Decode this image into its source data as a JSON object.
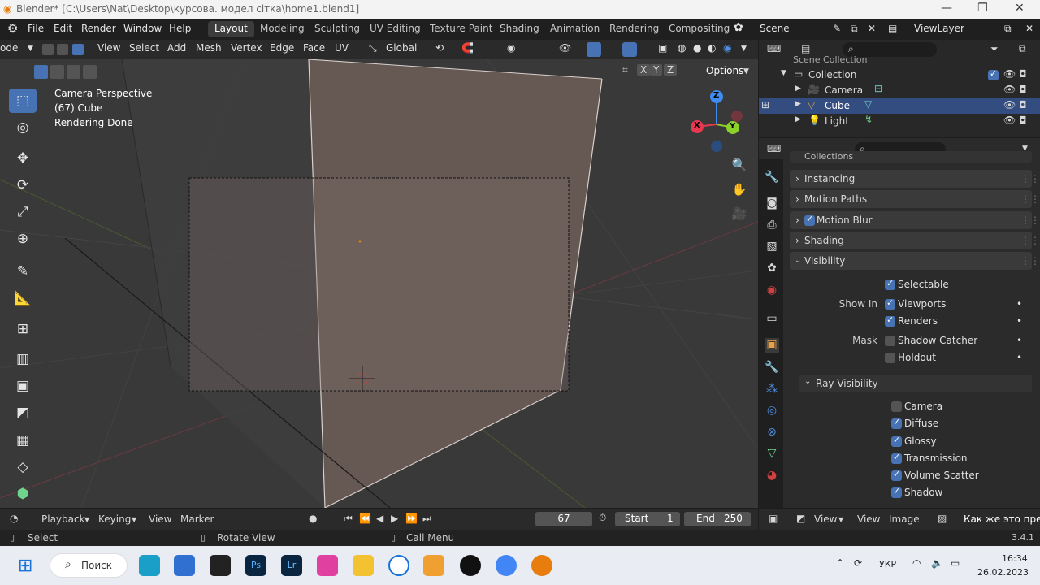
{
  "titlebar": {
    "title": "Blender* [C:\\Users\\Nat\\Desktop\\курсова. модел сітка\\home1.blend1]"
  },
  "menu": {
    "items": [
      "File",
      "Edit",
      "Render",
      "Window",
      "Help"
    ]
  },
  "workspaces": [
    "Layout",
    "Modeling",
    "Sculpting",
    "UV Editing",
    "Texture Paint",
    "Shading",
    "Animation",
    "Rendering",
    "Compositing"
  ],
  "scene": {
    "name": "Scene",
    "view_layer": "ViewLayer"
  },
  "viewport_header": {
    "mode": "ode",
    "items": [
      "View",
      "Select",
      "Add",
      "Mesh",
      "Vertex",
      "Edge",
      "Face",
      "UV"
    ],
    "orientation": "Global",
    "axes": [
      "X",
      "Y",
      "Z"
    ],
    "options": "Options"
  },
  "viewport": {
    "overlay_line1": "Camera Perspective",
    "overlay_line2": "(67) Cube",
    "overlay_line3": "Rendering Done",
    "gizmo": {
      "x": "X",
      "y": "Y",
      "z": "Z"
    }
  },
  "outliner": {
    "scene_collection": "Scene Collection",
    "collection": "Collection",
    "items": [
      {
        "name": "Camera",
        "selected": false
      },
      {
        "name": "Cube",
        "selected": true
      },
      {
        "name": "Light",
        "selected": false
      }
    ]
  },
  "properties": {
    "panels_top": [
      "Collections",
      "Instancing",
      "Motion Paths",
      "Motion Blur",
      "Shading",
      "Visibility"
    ],
    "selectable": "Selectable",
    "show_in": "Show In",
    "viewports": "Viewports",
    "renders": "Renders",
    "mask": "Mask",
    "shadow_catcher": "Shadow Catcher",
    "holdout": "Holdout",
    "ray_visibility": "Ray Visibility",
    "ray_items": [
      {
        "label": "Camera",
        "checked": false
      },
      {
        "label": "Diffuse",
        "checked": true
      },
      {
        "label": "Glossy",
        "checked": true
      },
      {
        "label": "Transmission",
        "checked": true
      },
      {
        "label": "Volume Scatter",
        "checked": true
      },
      {
        "label": "Shadow",
        "checked": true
      }
    ]
  },
  "timeline": {
    "playback": "Playback",
    "keying": "Keying",
    "view": "View",
    "marker": "Marker",
    "frame": "67",
    "start_label": "Start",
    "start": "1",
    "end_label": "End",
    "end": "250"
  },
  "image_header": {
    "view": "View",
    "view2": "View",
    "image": "Image",
    "name": "Как же это прек"
  },
  "statusbar": {
    "select": "Select",
    "rotate": "Rotate View",
    "call_menu": "Call Menu",
    "version": "3.4.1"
  },
  "taskbar": {
    "search": "Поиск",
    "lang": "УКР",
    "time": "16:34",
    "date": "26.02.2023"
  },
  "colors": {
    "accent": "#4772b3",
    "x_axis": "#e8384f",
    "y_axis": "#8bd12a",
    "z_axis": "#3f8cf0"
  }
}
